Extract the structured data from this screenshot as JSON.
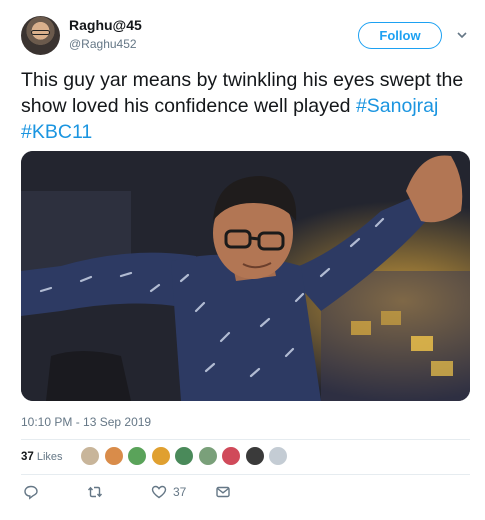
{
  "author": {
    "display_name": "Raghu@45",
    "handle": "@Raghu452"
  },
  "follow_label": "Follow",
  "tweet": {
    "text_parts": [
      "This guy yar means by twinkling his eyes swept the show loved his confidence well played ",
      " "
    ],
    "hashtags": [
      "#Sanojraj",
      "#KBC11"
    ]
  },
  "timestamp": "10:10 PM - 13 Sep 2019",
  "likes": {
    "count": "37",
    "label": "Likes"
  },
  "actions": {
    "reply_count": "",
    "retweet_count": "",
    "like_count": "37"
  },
  "colors": {
    "accent": "#1da1f2",
    "hashtag": "#1b95e0",
    "muted": "#657786",
    "shirt": "#2d3a63"
  },
  "icons": [
    "reply-icon",
    "retweet-icon",
    "like-icon",
    "message-icon",
    "chevron-down-icon"
  ]
}
